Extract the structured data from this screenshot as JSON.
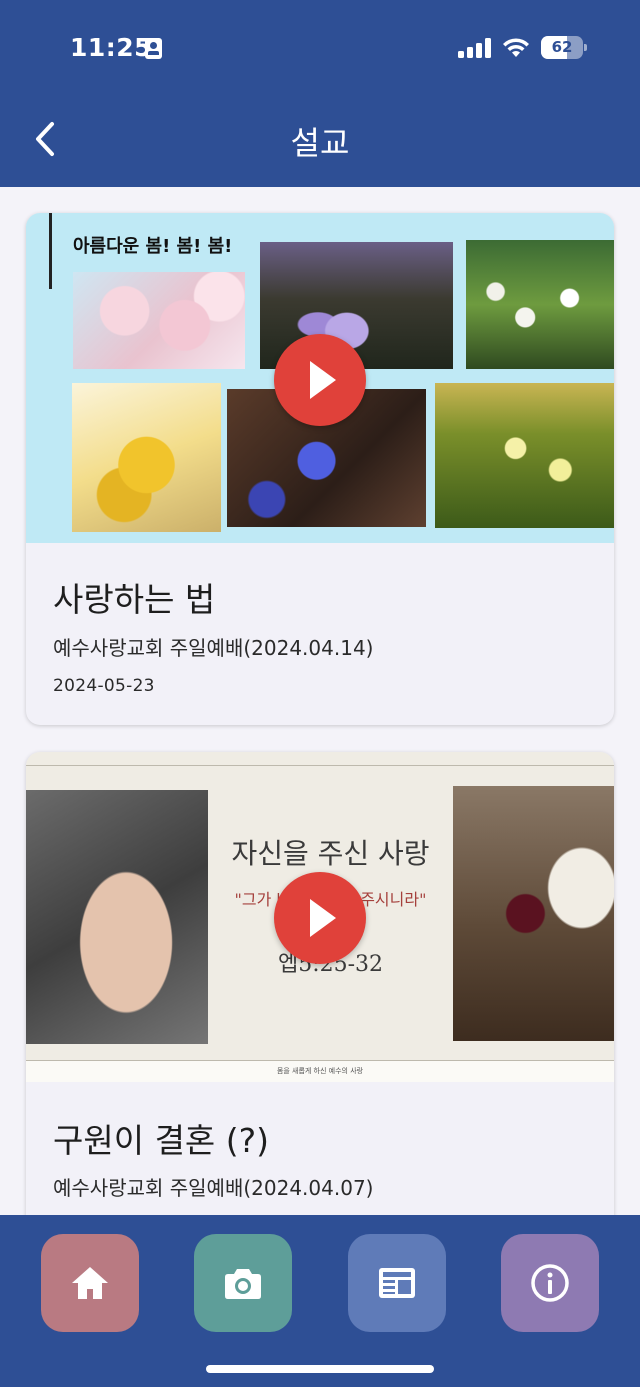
{
  "status_bar": {
    "time": "11:25",
    "battery_level": "62",
    "battery_fraction": 0.62
  },
  "header": {
    "title": "설교"
  },
  "sermons": [
    {
      "thumbnail_heading": "아름다운 봄! 봄! 봄!",
      "title": "사랑하는 법",
      "subtitle": "예수사랑교회 주일예배(2024.04.14)",
      "date": "2024-05-23"
    },
    {
      "thumbnail_title": "자신을 주신 사랑",
      "thumbnail_quote": "\"그가 바로 몸의 구주시니라\"",
      "thumbnail_verse": "엡5:25-32",
      "thumbnail_footer": "몸을 새롭게 하신 예수의 사랑",
      "title": "구원이 결혼 (?)",
      "subtitle": "예수사랑교회 주일예배(2024.04.07)"
    }
  ],
  "nav": [
    {
      "icon": "home-icon",
      "color": "#b97a82"
    },
    {
      "icon": "camera-icon",
      "color": "#5e9e99"
    },
    {
      "icon": "newspaper-icon",
      "color": "#5f7bb8"
    },
    {
      "icon": "info-icon",
      "color": "#8e7ab2"
    }
  ],
  "colors": {
    "primary": "#2e4f95",
    "play": "#e0413a",
    "background": "#f4f3f9"
  }
}
